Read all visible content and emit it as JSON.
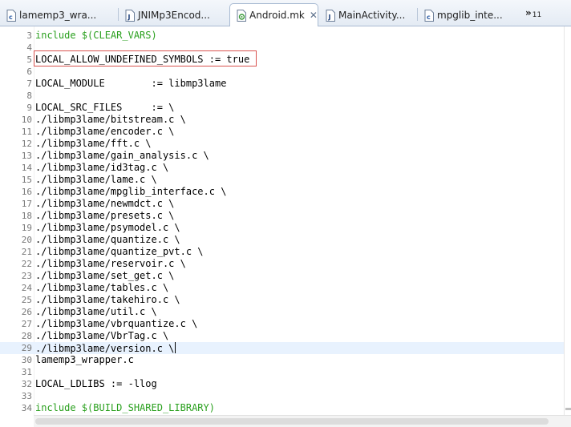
{
  "tabs": [
    {
      "label": "lamemp3_wra...",
      "icon": "c-file-icon",
      "active": false,
      "closable": false
    },
    {
      "label": "JNIMp3Encod...",
      "icon": "java-file-icon",
      "active": false,
      "closable": false
    },
    {
      "label": "Android.mk",
      "icon": "makefile-icon",
      "active": true,
      "closable": true
    },
    {
      "label": "MainActivity...",
      "icon": "java-file-icon",
      "active": false,
      "closable": false
    },
    {
      "label": "mpglib_inte...",
      "icon": "c-file-icon",
      "active": false,
      "closable": false
    }
  ],
  "overflow": {
    "chevron": "»",
    "count": "11"
  },
  "colors": {
    "keyword": "#2aa01e",
    "text": "#000000",
    "line_number": "#787878",
    "current_line": "#e8f2fe",
    "highlight_box": "#d9534f"
  },
  "lines": [
    {
      "n": "3",
      "kw": "include",
      "rest": " $(CLEAR_VARS)"
    },
    {
      "n": "4",
      "kw": "",
      "rest": ""
    },
    {
      "n": "5",
      "kw": "",
      "rest": "LOCAL_ALLOW_UNDEFINED_SYMBOLS := true"
    },
    {
      "n": "6",
      "kw": "",
      "rest": ""
    },
    {
      "n": "7",
      "kw": "",
      "rest": "LOCAL_MODULE        := libmp3lame"
    },
    {
      "n": "8",
      "kw": "",
      "rest": ""
    },
    {
      "n": "9",
      "kw": "",
      "rest": "LOCAL_SRC_FILES     := \\"
    },
    {
      "n": "10",
      "kw": "",
      "rest": "./libmp3lame/bitstream.c \\"
    },
    {
      "n": "11",
      "kw": "",
      "rest": "./libmp3lame/encoder.c \\"
    },
    {
      "n": "12",
      "kw": "",
      "rest": "./libmp3lame/fft.c \\"
    },
    {
      "n": "13",
      "kw": "",
      "rest": "./libmp3lame/gain_analysis.c \\"
    },
    {
      "n": "14",
      "kw": "",
      "rest": "./libmp3lame/id3tag.c \\"
    },
    {
      "n": "15",
      "kw": "",
      "rest": "./libmp3lame/lame.c \\"
    },
    {
      "n": "16",
      "kw": "",
      "rest": "./libmp3lame/mpglib_interface.c \\"
    },
    {
      "n": "17",
      "kw": "",
      "rest": "./libmp3lame/newmdct.c \\"
    },
    {
      "n": "18",
      "kw": "",
      "rest": "./libmp3lame/presets.c \\"
    },
    {
      "n": "19",
      "kw": "",
      "rest": "./libmp3lame/psymodel.c \\"
    },
    {
      "n": "20",
      "kw": "",
      "rest": "./libmp3lame/quantize.c \\"
    },
    {
      "n": "21",
      "kw": "",
      "rest": "./libmp3lame/quantize_pvt.c \\"
    },
    {
      "n": "22",
      "kw": "",
      "rest": "./libmp3lame/reservoir.c \\"
    },
    {
      "n": "23",
      "kw": "",
      "rest": "./libmp3lame/set_get.c \\"
    },
    {
      "n": "24",
      "kw": "",
      "rest": "./libmp3lame/tables.c \\"
    },
    {
      "n": "25",
      "kw": "",
      "rest": "./libmp3lame/takehiro.c \\"
    },
    {
      "n": "26",
      "kw": "",
      "rest": "./libmp3lame/util.c \\"
    },
    {
      "n": "27",
      "kw": "",
      "rest": "./libmp3lame/vbrquantize.c \\"
    },
    {
      "n": "28",
      "kw": "",
      "rest": "./libmp3lame/VbrTag.c \\"
    },
    {
      "n": "29",
      "kw": "",
      "rest": "./libmp3lame/version.c \\",
      "current": true
    },
    {
      "n": "30",
      "kw": "",
      "rest": "lamemp3_wrapper.c"
    },
    {
      "n": "31",
      "kw": "",
      "rest": ""
    },
    {
      "n": "32",
      "kw": "",
      "rest": "LOCAL_LDLIBS := -llog"
    },
    {
      "n": "33",
      "kw": "",
      "rest": ""
    },
    {
      "n": "34",
      "kw": "include",
      "rest": " $(BUILD_SHARED_LIBRARY)"
    }
  ]
}
